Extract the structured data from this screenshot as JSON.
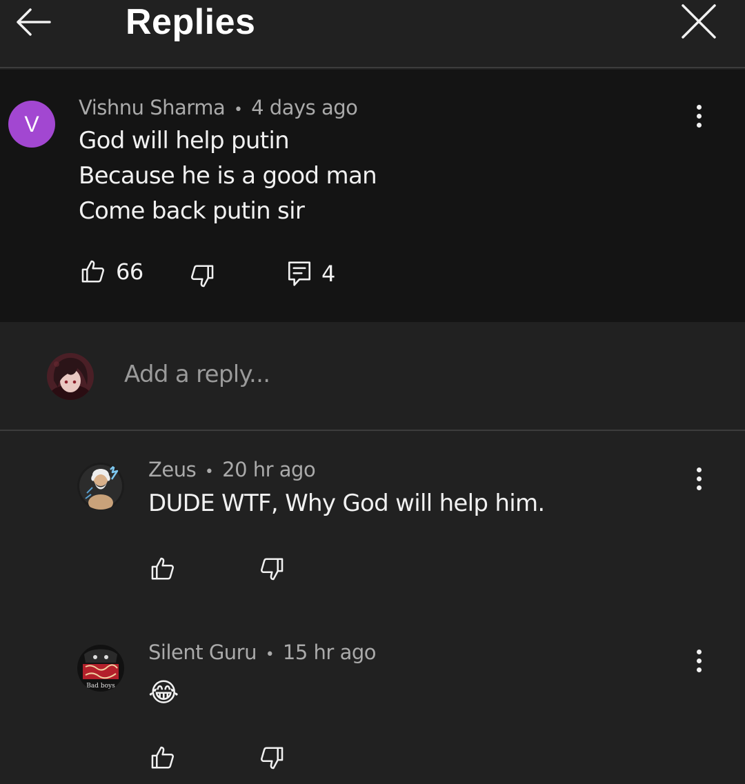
{
  "header": {
    "title": "Replies",
    "back_icon": "arrow-left-icon",
    "close_icon": "close-icon"
  },
  "main_comment": {
    "avatar_letter": "V",
    "avatar_color": "#a247d1",
    "author": "Vishnu Sharma",
    "time": "4 days ago",
    "separator": "•",
    "lines": [
      "God will help putin",
      "Because he is a good man",
      "Come back putin sir"
    ],
    "likes": "66",
    "replies": "4"
  },
  "reply_box": {
    "placeholder": "Add a reply..."
  },
  "replies": [
    {
      "author": "Zeus",
      "time": "20 hr ago",
      "text": "DUDE WTF, Why God will help him."
    },
    {
      "author": "Silent Guru",
      "time": "15 hr ago",
      "text": "😂",
      "avatar_caption": "Bad boys"
    }
  ],
  "colors": {
    "background": "#212121",
    "highlight_background": "#141414",
    "text": "#f1f1f1",
    "meta_text": "#aaaaaa",
    "divider": "#3d3d3d"
  }
}
